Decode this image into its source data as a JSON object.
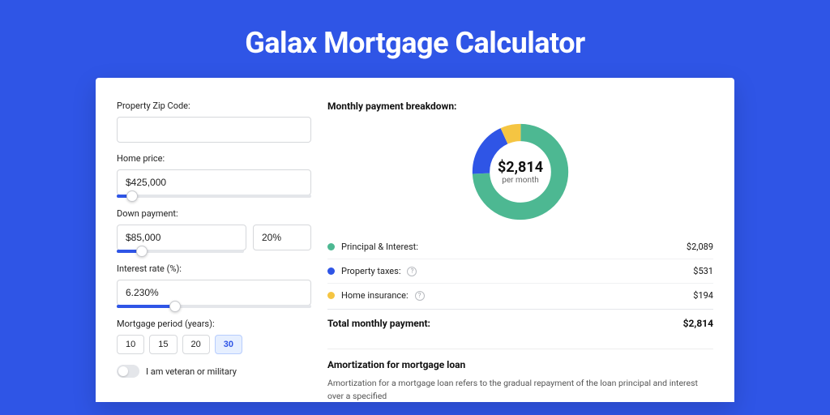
{
  "title": "Galax Mortgage Calculator",
  "form": {
    "zip_label": "Property Zip Code:",
    "zip_value": "",
    "home_price_label": "Home price:",
    "home_price_value": "$425,000",
    "home_price_slider_pct": 8,
    "down_payment_label": "Down payment:",
    "down_payment_value": "$85,000",
    "down_payment_pct_value": "20%",
    "down_payment_slider_pct": 20,
    "interest_label": "Interest rate (%):",
    "interest_value": "6.230%",
    "interest_slider_pct": 30,
    "period_label": "Mortgage period (years):",
    "period_options": [
      "10",
      "15",
      "20",
      "30"
    ],
    "period_selected": "30",
    "veteran_label": "I am veteran or military"
  },
  "breakdown": {
    "title": "Monthly payment breakdown:",
    "center_value": "$2,814",
    "center_label": "per month",
    "items": [
      {
        "label": "Principal & Interest:",
        "value": "$2,089",
        "color": "#4DB892",
        "info": false
      },
      {
        "label": "Property taxes:",
        "value": "$531",
        "color": "#2F55E6",
        "info": true
      },
      {
        "label": "Home insurance:",
        "value": "$194",
        "color": "#F5C542",
        "info": true
      }
    ],
    "total_label": "Total monthly payment:",
    "total_value": "$2,814"
  },
  "amortization": {
    "title": "Amortization for mortgage loan",
    "text": "Amortization for a mortgage loan refers to the gradual repayment of the loan principal and interest over a specified"
  },
  "chart_data": {
    "type": "pie",
    "title": "Monthly payment breakdown",
    "series": [
      {
        "name": "Principal & Interest",
        "value": 2089,
        "color": "#4DB892"
      },
      {
        "name": "Property taxes",
        "value": 531,
        "color": "#2F55E6"
      },
      {
        "name": "Home insurance",
        "value": 194,
        "color": "#F5C542"
      }
    ],
    "total": 2814,
    "unit": "USD per month"
  }
}
